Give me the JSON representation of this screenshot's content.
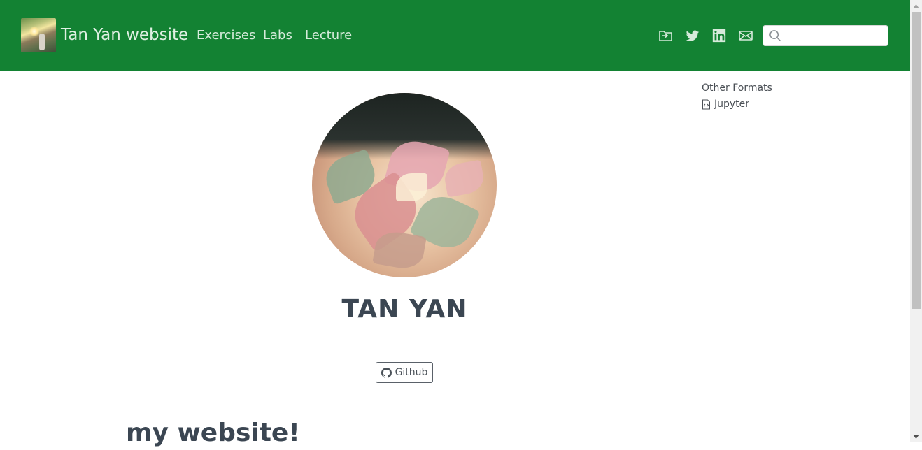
{
  "navbar": {
    "brand_title": "Tan Yan website",
    "links": [
      {
        "label": "Exercises"
      },
      {
        "label": "Labs"
      },
      {
        "label": "Lecture"
      }
    ],
    "icons": [
      "folder-open-icon",
      "twitter-icon",
      "linkedin-icon",
      "envelope-icon"
    ],
    "search": {
      "placeholder": "",
      "value": ""
    },
    "bg_color": "#138233"
  },
  "sidebar": {
    "other_formats_title": "Other Formats",
    "formats": [
      {
        "label": "Jupyter",
        "icon": "file-code-icon"
      }
    ]
  },
  "profile": {
    "name": "TAN YAN",
    "links": [
      {
        "label": "Github",
        "icon": "github-icon"
      }
    ]
  },
  "content": {
    "heading": "my website!"
  }
}
